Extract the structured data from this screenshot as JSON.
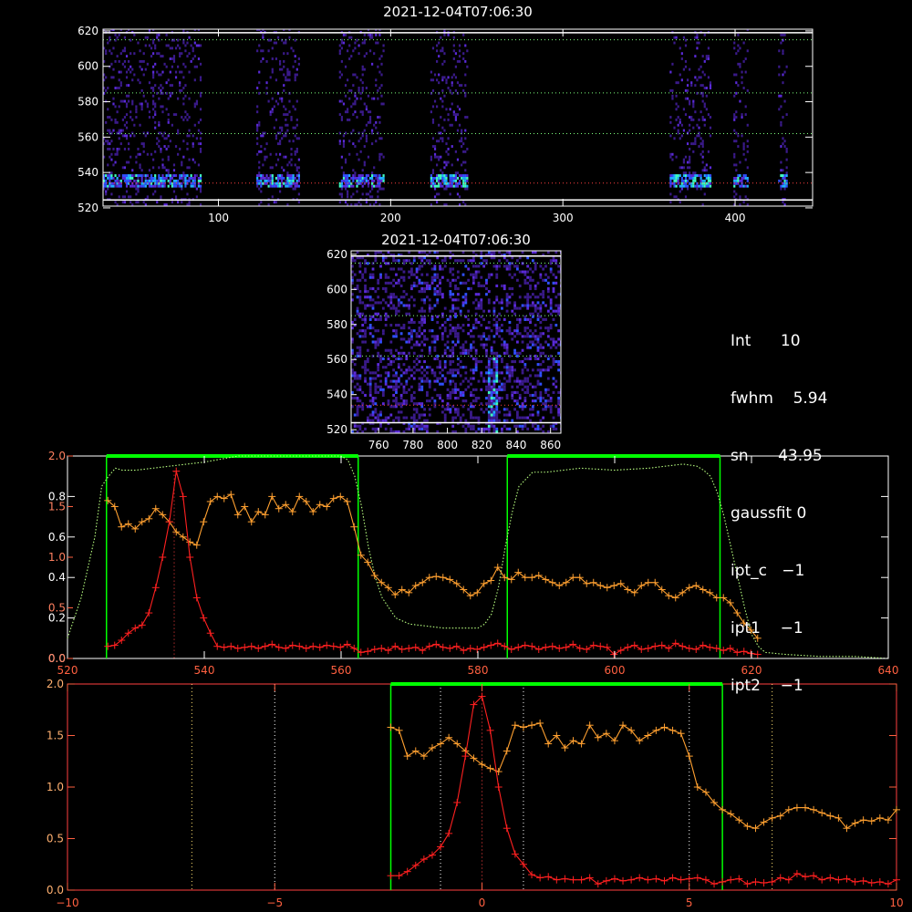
{
  "image_panel_top": {
    "title": "2021-12-04T07:06:30",
    "x_ticks": [
      "100",
      "200",
      "300",
      "400"
    ],
    "y_ticks": [
      "520",
      "540",
      "560",
      "580",
      "600",
      "620"
    ]
  },
  "image_panel_mid": {
    "title": "2021-12-04T07:06:30",
    "x_ticks": [
      "760",
      "780",
      "800",
      "820",
      "840",
      "860"
    ],
    "y_ticks": [
      "520",
      "540",
      "560",
      "580",
      "600",
      "620"
    ]
  },
  "info_panel": [
    {
      "label": "Int",
      "value": "10"
    },
    {
      "label": "fwhm",
      "value": "5.94"
    },
    {
      "label": "sn",
      "value": "43.95"
    },
    {
      "label": "gaussfit",
      "value": "0"
    },
    {
      "label": "ipt_c",
      "value": "−1"
    },
    {
      "label": "ipt1",
      "value": "−1"
    },
    {
      "label": "ipt2",
      "value": "−1"
    }
  ],
  "colors": {
    "red_series": "#ff2020",
    "orange_series": "#ffa030",
    "green_lines": "#00ff00",
    "transmission_curve": "#b8ff80"
  },
  "chart_data": [
    {
      "type": "line",
      "xlim": [
        520,
        640
      ],
      "ylim_left_red": [
        0,
        2
      ],
      "ylim_left_white": [
        0,
        1
      ],
      "x_ticks": [
        "520",
        "540",
        "560",
        "580",
        "600",
        "620",
        "640"
      ],
      "y_ticks_white": [
        "0.0",
        "0.2",
        "0.4",
        "0.6",
        "0.8"
      ],
      "y_ticks_red": [
        "0.0",
        "0.5",
        "1.0",
        "1.5",
        "2.0"
      ],
      "green_windows": [
        [
          525.7,
          562.5
        ],
        [
          584.3,
          615.4
        ]
      ],
      "series": [
        {
          "x": [
            525.9,
            526.9,
            527.9,
            528.9,
            529.9,
            530.9,
            531.9,
            532.9,
            533.9,
            534.9,
            535.9,
            536.9,
            537.9,
            538.9,
            539.9,
            540.9,
            541.9,
            542.9,
            543.9,
            544.9,
            545.9,
            546.9,
            547.9,
            548.9,
            549.9,
            550.9,
            551.9,
            552.9,
            553.9,
            554.9,
            555.9,
            556.9,
            557.9,
            558.9,
            559.9,
            560.9,
            561.9,
            562.9,
            563.9,
            564.9,
            565.9,
            566.9,
            567.9,
            568.9,
            569.9,
            570.9,
            571.9,
            572.9,
            573.9,
            574.9,
            575.9,
            576.9,
            577.9,
            578.9,
            579.9,
            580.9,
            581.9,
            582.9,
            583.9,
            584.9,
            585.9,
            586.9,
            587.9,
            588.9,
            589.9,
            590.9,
            591.9,
            592.9,
            593.9,
            594.9,
            595.9,
            596.9,
            597.9,
            598.9,
            599.9,
            600.9,
            601.9,
            602.9,
            603.9,
            604.9,
            605.9,
            606.9,
            607.9,
            608.9,
            609.9,
            610.9,
            611.9,
            612.9,
            613.9,
            614.9,
            615.9,
            616.9,
            617.9,
            618.9,
            619.9,
            620.9
          ],
          "values": [
            0.12,
            0.13,
            0.18,
            0.25,
            0.3,
            0.33,
            0.45,
            0.7,
            1.0,
            1.35,
            1.85,
            1.6,
            1.0,
            0.6,
            0.4,
            0.25,
            0.12,
            0.11,
            0.12,
            0.1,
            0.11,
            0.12,
            0.1,
            0.12,
            0.14,
            0.11,
            0.1,
            0.13,
            0.12,
            0.1,
            0.12,
            0.11,
            0.13,
            0.12,
            0.11,
            0.14,
            0.1,
            0.06,
            0.07,
            0.09,
            0.1,
            0.08,
            0.12,
            0.09,
            0.1,
            0.11,
            0.08,
            0.12,
            0.14,
            0.11,
            0.1,
            0.12,
            0.08,
            0.1,
            0.09,
            0.11,
            0.13,
            0.15,
            0.12,
            0.09,
            0.11,
            0.13,
            0.12,
            0.09,
            0.11,
            0.12,
            0.1,
            0.11,
            0.14,
            0.1,
            0.09,
            0.13,
            0.12,
            0.11,
            0.04,
            0.08,
            0.11,
            0.13,
            0.09,
            0.1,
            0.12,
            0.13,
            0.1,
            0.15,
            0.12,
            0.1,
            0.09,
            0.13,
            0.11,
            0.1,
            0.08,
            0.1,
            0.06,
            0.07,
            0.05,
            0.04
          ]
        },
        {
          "x": [
            525.9,
            526.9,
            527.9,
            528.9,
            529.9,
            530.9,
            531.9,
            532.9,
            533.9,
            534.9,
            535.9,
            536.9,
            537.9,
            538.9,
            539.9,
            540.9,
            541.9,
            542.9,
            543.9,
            544.9,
            545.9,
            546.9,
            547.9,
            548.9,
            549.9,
            550.9,
            551.9,
            552.9,
            553.9,
            554.9,
            555.9,
            556.9,
            557.9,
            558.9,
            559.9,
            560.9,
            561.9,
            562.9,
            563.9,
            564.9,
            565.9,
            566.9,
            567.9,
            568.9,
            569.9,
            570.9,
            571.9,
            572.9,
            573.9,
            574.9,
            575.9,
            576.9,
            577.9,
            578.9,
            579.9,
            580.9,
            581.9,
            582.9,
            583.9,
            584.9,
            585.9,
            586.9,
            587.9,
            588.9,
            589.9,
            590.9,
            591.9,
            592.9,
            593.9,
            594.9,
            595.9,
            596.9,
            597.9,
            598.9,
            599.9,
            600.9,
            601.9,
            602.9,
            603.9,
            604.9,
            605.9,
            606.9,
            607.9,
            608.9,
            609.9,
            610.9,
            611.9,
            612.9,
            613.9,
            614.9,
            615.9,
            616.9,
            617.9,
            618.9,
            619.9,
            620.9
          ],
          "values": [
            1.56,
            1.5,
            1.3,
            1.33,
            1.28,
            1.35,
            1.38,
            1.48,
            1.42,
            1.35,
            1.25,
            1.2,
            1.15,
            1.12,
            1.35,
            1.55,
            1.6,
            1.58,
            1.62,
            1.42,
            1.5,
            1.35,
            1.45,
            1.42,
            1.6,
            1.48,
            1.52,
            1.45,
            1.6,
            1.55,
            1.45,
            1.52,
            1.5,
            1.58,
            1.6,
            1.55,
            1.3,
            1.02,
            0.95,
            0.82,
            0.75,
            0.7,
            0.63,
            0.68,
            0.65,
            0.72,
            0.75,
            0.8,
            0.81,
            0.8,
            0.78,
            0.74,
            0.68,
            0.62,
            0.65,
            0.74,
            0.77,
            0.9,
            0.8,
            0.78,
            0.85,
            0.8,
            0.8,
            0.82,
            0.78,
            0.75,
            0.72,
            0.75,
            0.8,
            0.8,
            0.74,
            0.75,
            0.72,
            0.7,
            0.72,
            0.74,
            0.68,
            0.65,
            0.72,
            0.75,
            0.75,
            0.68,
            0.62,
            0.6,
            0.65,
            0.7,
            0.72,
            0.68,
            0.65,
            0.6,
            0.6,
            0.55,
            0.45,
            0.35,
            0.28,
            0.2
          ]
        },
        {
          "x": [
            520,
            522,
            524,
            525,
            526,
            527,
            528,
            530,
            535,
            540,
            545,
            550,
            555,
            560,
            561,
            562,
            563,
            564,
            565,
            566,
            568,
            570,
            575,
            580,
            581,
            582,
            583,
            584,
            585,
            586,
            588,
            590,
            595,
            600,
            605,
            610,
            612,
            613,
            614,
            615,
            616,
            617,
            618,
            619,
            620,
            621,
            622,
            625,
            630,
            635,
            640
          ],
          "values": [
            0.1,
            0.3,
            0.6,
            0.85,
            0.9,
            0.94,
            0.93,
            0.93,
            0.95,
            0.97,
            1.0,
            1.0,
            1.0,
            1.0,
            0.98,
            0.9,
            0.75,
            0.55,
            0.4,
            0.3,
            0.2,
            0.17,
            0.15,
            0.15,
            0.17,
            0.22,
            0.35,
            0.55,
            0.72,
            0.85,
            0.92,
            0.92,
            0.94,
            0.93,
            0.94,
            0.96,
            0.95,
            0.93,
            0.9,
            0.82,
            0.7,
            0.55,
            0.4,
            0.25,
            0.12,
            0.06,
            0.03,
            0.02,
            0.01,
            0.01,
            0.0
          ]
        }
      ]
    },
    {
      "type": "line",
      "xlim": [
        -10,
        10
      ],
      "ylim": [
        0,
        2
      ],
      "x_ticks": [
        "−10",
        "−5",
        "0",
        "5",
        "10"
      ],
      "y_ticks": [
        "0.0",
        "0.5",
        "1.0",
        "1.5",
        "2.0"
      ],
      "green_window": [
        -2.2,
        5.8
      ],
      "dotted_lines": [
        -7,
        -5,
        -1,
        1,
        5,
        7
      ],
      "series": [
        {
          "x": [
            -2.2,
            -2.0,
            -1.8,
            -1.6,
            -1.4,
            -1.2,
            -1.0,
            -0.8,
            -0.6,
            -0.4,
            -0.2,
            0.0,
            0.2,
            0.4,
            0.6,
            0.8,
            1.0,
            1.2,
            1.4,
            1.6,
            1.8,
            2.0,
            2.2,
            2.4,
            2.6,
            2.8,
            3.0,
            3.2,
            3.4,
            3.6,
            3.8,
            4.0,
            4.2,
            4.4,
            4.6,
            4.8,
            5.0,
            5.2,
            5.4,
            5.6,
            5.8,
            6.0,
            6.2,
            6.4,
            6.6,
            6.8,
            7.0,
            7.2,
            7.4,
            7.6,
            7.8,
            8.0,
            8.2,
            8.4,
            8.6,
            8.8,
            9.0,
            9.2,
            9.4,
            9.6,
            9.8,
            10.0
          ],
          "values": [
            0.14,
            0.14,
            0.18,
            0.24,
            0.3,
            0.34,
            0.42,
            0.55,
            0.85,
            1.3,
            1.8,
            1.88,
            1.55,
            1.0,
            0.6,
            0.35,
            0.25,
            0.15,
            0.12,
            0.13,
            0.1,
            0.11,
            0.1,
            0.1,
            0.12,
            0.06,
            0.09,
            0.11,
            0.09,
            0.1,
            0.12,
            0.1,
            0.11,
            0.09,
            0.12,
            0.1,
            0.11,
            0.12,
            0.1,
            0.06,
            0.08,
            0.1,
            0.11,
            0.06,
            0.08,
            0.07,
            0.08,
            0.12,
            0.1,
            0.16,
            0.13,
            0.14,
            0.1,
            0.12,
            0.1,
            0.11,
            0.08,
            0.09,
            0.07,
            0.08,
            0.06,
            0.1
          ]
        },
        {
          "x": [
            -2.2,
            -2.0,
            -1.8,
            -1.6,
            -1.4,
            -1.2,
            -1.0,
            -0.8,
            -0.6,
            -0.4,
            -0.2,
            0.0,
            0.2,
            0.4,
            0.6,
            0.8,
            1.0,
            1.2,
            1.4,
            1.6,
            1.8,
            2.0,
            2.2,
            2.4,
            2.6,
            2.8,
            3.0,
            3.2,
            3.4,
            3.6,
            3.8,
            4.0,
            4.2,
            4.4,
            4.6,
            4.8,
            5.0,
            5.2,
            5.4,
            5.6,
            5.8,
            6.0,
            6.2,
            6.4,
            6.6,
            6.8,
            7.0,
            7.2,
            7.4,
            7.6,
            7.8,
            8.0,
            8.2,
            8.4,
            8.6,
            8.8,
            9.0,
            9.2,
            9.4,
            9.6,
            9.8,
            10.0
          ],
          "values": [
            1.58,
            1.55,
            1.3,
            1.35,
            1.3,
            1.38,
            1.42,
            1.48,
            1.42,
            1.35,
            1.28,
            1.22,
            1.18,
            1.15,
            1.35,
            1.6,
            1.58,
            1.6,
            1.62,
            1.42,
            1.5,
            1.38,
            1.45,
            1.42,
            1.6,
            1.48,
            1.52,
            1.45,
            1.6,
            1.55,
            1.45,
            1.5,
            1.55,
            1.58,
            1.55,
            1.52,
            1.3,
            1.0,
            0.95,
            0.85,
            0.78,
            0.74,
            0.68,
            0.62,
            0.6,
            0.66,
            0.7,
            0.72,
            0.78,
            0.8,
            0.8,
            0.78,
            0.75,
            0.72,
            0.7,
            0.6,
            0.65,
            0.68,
            0.67,
            0.7,
            0.68,
            0.78
          ]
        }
      ]
    }
  ]
}
